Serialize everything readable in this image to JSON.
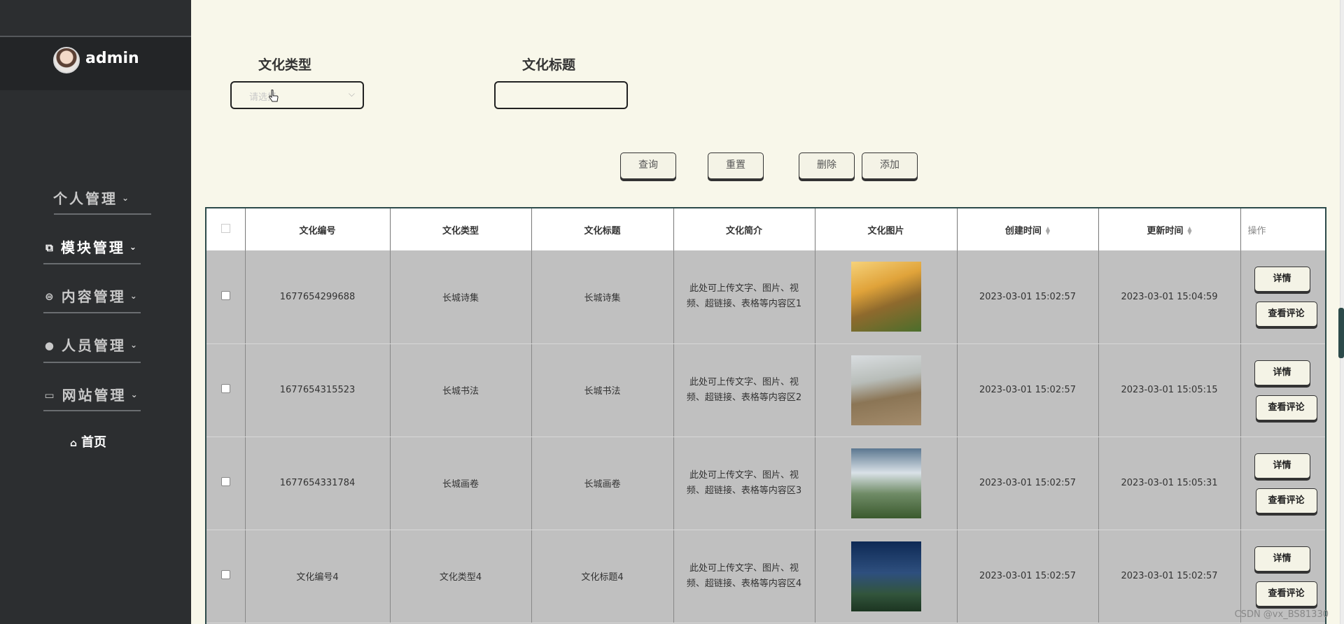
{
  "sidebar": {
    "username": "admin",
    "items": [
      {
        "label": "个人管理",
        "icon": ""
      },
      {
        "label": "模块管理",
        "icon": "module-icon"
      },
      {
        "label": "内容管理",
        "icon": "chat-icon"
      },
      {
        "label": "人员管理",
        "icon": "person-icon"
      },
      {
        "label": "网站管理",
        "icon": "monitor-icon"
      }
    ],
    "home": "首页"
  },
  "filters": {
    "type_label": "文化类型",
    "type_placeholder": "请选择",
    "title_label": "文化标题",
    "title_value": ""
  },
  "actions": {
    "query": "查询",
    "reset": "重置",
    "delete": "删除",
    "add": "添加"
  },
  "table": {
    "columns": [
      "文化编号",
      "文化类型",
      "文化标题",
      "文化简介",
      "文化图片",
      "创建时间",
      "更新时间",
      "操作"
    ],
    "rows": [
      {
        "id": "1677654299688",
        "type": "长城诗集",
        "title": "长城诗集",
        "intro": "此处可上传文字、图片、视频、超链接、表格等内容区1",
        "created": "2023-03-01 15:02:57",
        "updated": "2023-03-01 15:04:59"
      },
      {
        "id": "1677654315523",
        "type": "长城书法",
        "title": "长城书法",
        "intro": "此处可上传文字、图片、视频、超链接、表格等内容区2",
        "created": "2023-03-01 15:02:57",
        "updated": "2023-03-01 15:05:15"
      },
      {
        "id": "1677654331784",
        "type": "长城画卷",
        "title": "长城画卷",
        "intro": "此处可上传文字、图片、视频、超链接、表格等内容区3",
        "created": "2023-03-01 15:02:57",
        "updated": "2023-03-01 15:05:31"
      },
      {
        "id": "文化编号4",
        "type": "文化类型4",
        "title": "文化标题4",
        "intro": "此处可上传文字、图片、视频、超链接、表格等内容区4",
        "created": "2023-03-01 15:02:57",
        "updated": "2023-03-01 15:02:57"
      }
    ],
    "detail_label": "详情",
    "comment_label": "查看评论"
  },
  "watermark": "CSDN @vx_BS81330"
}
